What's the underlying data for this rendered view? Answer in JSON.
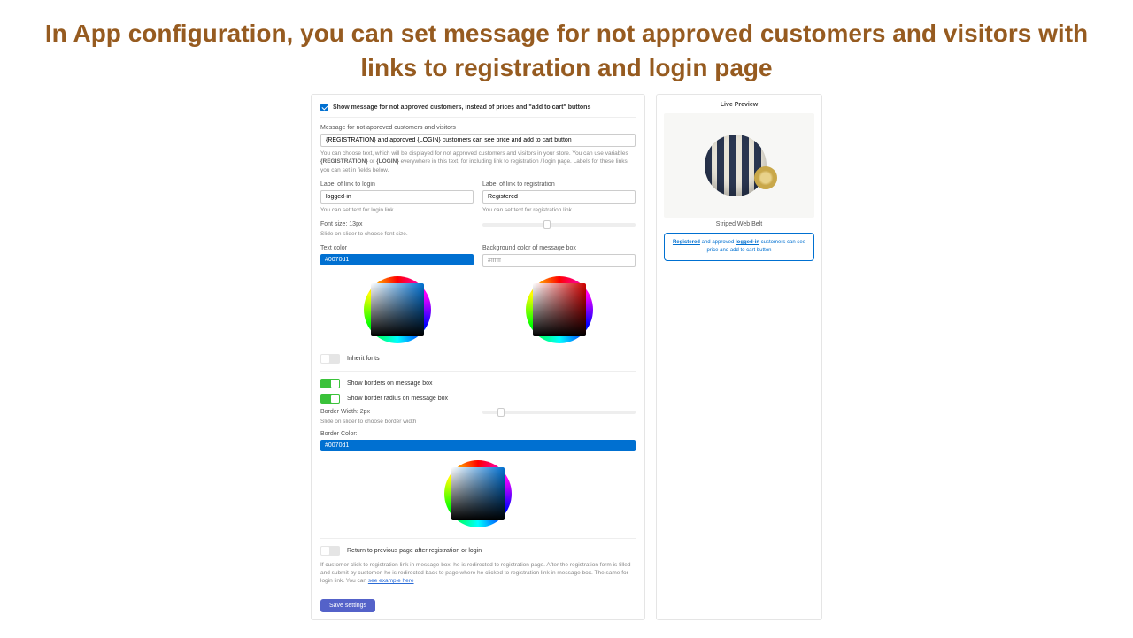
{
  "page_heading": "In App configuration, you can set message for not approved customers and visitors with links to registration and login page",
  "config": {
    "show_message_checkbox_label": "Show message for not approved customers, instead of prices and \"add to cart\" buttons",
    "message_label": "Message for not approved customers and visitors",
    "message_value": "{REGISTRATION} and approved {LOGIN} customers can see price and add to cart button",
    "message_help_pre": "You can choose text, which will be displayed for not approved customers and visitors in your store. You can use variables ",
    "message_help_reg": "{REGISTRATION}",
    "message_help_mid": " or ",
    "message_help_login": "{LOGIN}",
    "message_help_post": " everywhere in this text, for including link to registration / login page. Labels for these links, you can set in fields below.",
    "login_link_label": "Label of link to login",
    "login_link_value": "logged-in",
    "login_help": "You can set text for login link.",
    "registration_link_label": "Label of link to registration",
    "registration_link_value": "Registered",
    "registration_help": "You can set text for registration link.",
    "font_size_label": "Font size: 13px",
    "font_size_help": "Slide on slider to choose font size.",
    "font_size_value": 13,
    "font_size_pct": 40,
    "text_color_label": "Text color",
    "text_color_value": "#0070d1",
    "bg_color_label": "Background color of message box",
    "bg_color_value": "#ffffff",
    "inherit_fonts_label": "Inherit fonts",
    "show_borders_label": "Show borders on message box",
    "show_radius_label": "Show border radius on message box",
    "border_width_label": "Border Width: 2px",
    "border_width_help": "Slide on slider to choose border width",
    "border_width_value": 2,
    "border_width_pct": 10,
    "border_color_label": "Border Color:",
    "border_color_value": "#0070d1",
    "return_prev_label": "Return to previous page after registration or login",
    "return_help": "If customer click to registration link in message box, he is redirected to registration page. After the registration form is filled and submit by customer, he is redirected back to page where he clicked to registration link in message box. The same for login link. You can ",
    "example_link_text": "see example here",
    "save_button": "Save settings"
  },
  "preview": {
    "title": "Live Preview",
    "product_name": "Striped Web Belt",
    "msg_reg": "Registered",
    "msg_and": " and approved ",
    "msg_login": "logged-in",
    "msg_tail": " customers can see price and add to cart button"
  }
}
